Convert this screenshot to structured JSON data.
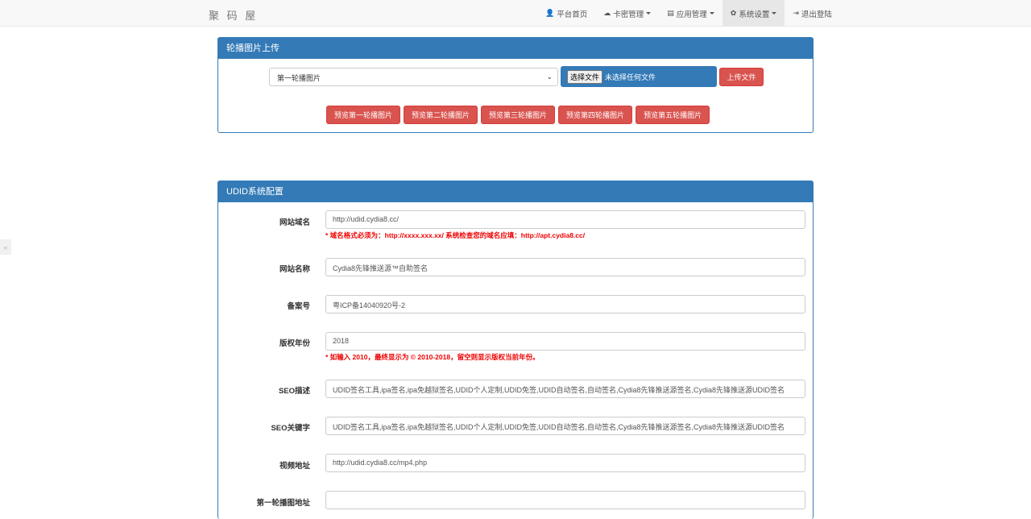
{
  "brand": "聚 码 屋",
  "nav": [
    {
      "icon": "👤",
      "label": "平台首页",
      "caret": false
    },
    {
      "icon": "☁",
      "label": "卡密管理",
      "caret": true
    },
    {
      "icon": "▤",
      "label": "应用管理",
      "caret": true
    },
    {
      "icon": "✿",
      "label": "系统设置",
      "caret": true
    },
    {
      "icon": "⇥",
      "label": "退出登陆",
      "caret": false
    }
  ],
  "side_handle": "«",
  "carousel_panel": {
    "title": "轮播图片上传",
    "select_value": "第一轮播图片",
    "file_button": "选择文件",
    "file_status": "未选择任何文件",
    "upload_label": "上传文件",
    "previews": [
      "预览第一轮播图片",
      "预览第二轮播图片",
      "预览第三轮播图片",
      "预览第四轮播图片",
      "预览第五轮播图片"
    ]
  },
  "config_panel": {
    "title": "UDID系统配置",
    "fields": [
      {
        "label": "网站域名",
        "value": "http://udid.cydia8.cc/",
        "hint": "* 域名格式必须为：http://xxxx.xxx.xx/ 系统检查您的域名应填：http://apt.cydia8.cc/"
      },
      {
        "label": "网站名称",
        "value": "Cydia8先锋推送源™自助签名",
        "hint": ""
      },
      {
        "label": "备案号",
        "value": "粤ICP备14040920号-2",
        "hint": ""
      },
      {
        "label": "版权年份",
        "value": "2018",
        "hint": "* 如输入 2010，最终显示为 © 2010-2018，留空则显示版权当前年份。"
      },
      {
        "label": "SEO描述",
        "value": "UDID签名工具,ipa签名,ipa免越狱签名,UDID个人定制,UDID免签,UDID自动签名,自动签名,Cydia8先锋推送源签名,Cydia8先锋推送源UDID签名",
        "hint": ""
      },
      {
        "label": "SEO关键字",
        "value": "UDID签名工具,ipa签名,ipa免越狱签名,UDID个人定制,UDID免签,UDID自动签名,自动签名,Cydia8先锋推送源签名,Cydia8先锋推送源UDID签名",
        "hint": ""
      },
      {
        "label": "视频地址",
        "value": "http://udid.cydia8.cc/mp4.php",
        "hint": ""
      },
      {
        "label": "第一轮播图地址",
        "value": "",
        "hint": ""
      }
    ]
  }
}
